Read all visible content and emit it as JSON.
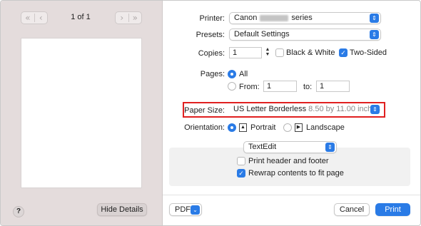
{
  "preview": {
    "first_prev_glyphs": [
      "«",
      "‹"
    ],
    "next_last_glyphs": [
      "›",
      "»"
    ],
    "page_indicator": "1 of 1",
    "help_label": "?",
    "hide_details_label": "Hide Details"
  },
  "settings": {
    "printer": {
      "label": "Printer:",
      "value_prefix": "Canon",
      "value_suffix": "series"
    },
    "presets": {
      "label": "Presets:",
      "value": "Default Settings"
    },
    "copies": {
      "label": "Copies:",
      "value": "1",
      "black_white_label": "Black & White",
      "black_white_checked": false,
      "two_sided_label": "Two-Sided",
      "two_sided_checked": true
    },
    "pages": {
      "label": "Pages:",
      "all_label": "All",
      "all_selected": true,
      "from_label": "From:",
      "from_value": "1",
      "to_label": "to:",
      "to_value": "1"
    },
    "paper_size": {
      "label": "Paper Size:",
      "value": "US Letter Borderless",
      "detail": "8.50 by 11.00 inches"
    },
    "orientation": {
      "label": "Orientation:",
      "portrait_label": "Portrait",
      "portrait_selected": true,
      "landscape_label": "Landscape"
    },
    "app_section": {
      "value": "TextEdit"
    },
    "print_header_footer": {
      "label": "Print header and footer",
      "checked": false
    },
    "rewrap": {
      "label": "Rewrap contents to fit page",
      "checked": true
    }
  },
  "footer": {
    "pdf_label": "PDF",
    "cancel_label": "Cancel",
    "print_label": "Print"
  },
  "colors": {
    "accent": "#2a7be6",
    "highlight": "#e02020",
    "sidebar_bg": "#e4dcdc"
  }
}
